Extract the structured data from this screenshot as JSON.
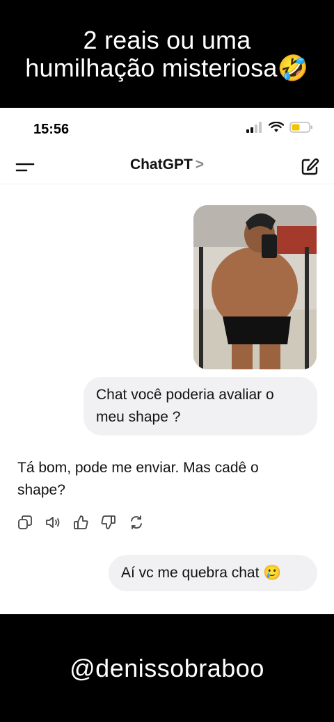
{
  "overlay": {
    "top_caption_line1": "2 reais ou uma",
    "top_caption_line2": "humilhação misteriosa🤣",
    "bottom_caption": "@denissobraboo"
  },
  "status_bar": {
    "time": "15:56"
  },
  "nav": {
    "title": "ChatGPT",
    "chevron": ">"
  },
  "messages": {
    "user_photo_alt": "shirtless mirror selfie at gym",
    "user_1": "Chat você poderia avaliar o meu shape ?",
    "assistant_1": "Tá bom, pode me enviar. Mas cadê o shape?",
    "user_2": "Aí vc me quebra chat 🥲"
  },
  "icons": {
    "menu": "menu-icon",
    "edit": "new-chat-edit-icon",
    "copy": "copy-icon",
    "speaker": "read-aloud-icon",
    "thumbs_up": "thumbs-up-icon",
    "thumbs_down": "thumbs-down-icon",
    "regenerate": "regenerate-icon"
  },
  "colors": {
    "battery": "#f5c400",
    "bubble": "#f1f1f3",
    "caption_bg": "#000000"
  }
}
